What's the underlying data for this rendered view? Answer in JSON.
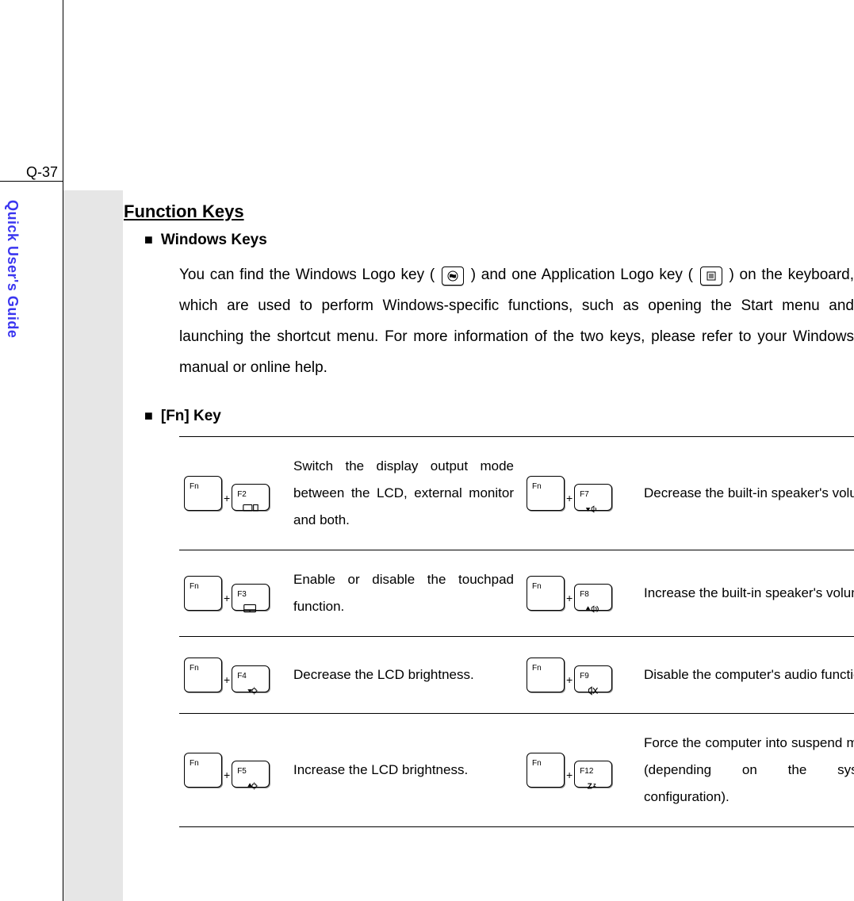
{
  "page_number": "Q-37",
  "side_tab": "Quick User's Guide",
  "section_title": "Function Keys",
  "subsections": {
    "windows": {
      "title": "Windows Keys",
      "para_before": "You can find the Windows Logo key (",
      "mid": ") and one Application Logo key (",
      "after": ") on the keyboard, which are used to perform Windows-specific functions, such as opening the Start menu and launching the shortcut menu.  For more information of the two keys, please refer to your Windows manual or online help."
    },
    "fnkey": {
      "title": "[Fn] Key"
    }
  },
  "fn_label": "Fn",
  "plus": "+",
  "fn_rows": [
    {
      "left_key": "F2",
      "left_icon": "display-icon",
      "left_desc": "Switch the display output mode between the LCD, external monitor and both.",
      "right_key": "F7",
      "right_icon": "vol-down-icon",
      "right_desc": "Decrease the built-in speaker's volume."
    },
    {
      "left_key": "F3",
      "left_icon": "touchpad-icon",
      "left_desc": "Enable or disable the touchpad function.",
      "right_key": "F8",
      "right_icon": "vol-up-icon",
      "right_desc": "Increase the built-in speaker's volume."
    },
    {
      "left_key": "F4",
      "left_icon": "bright-down-icon",
      "left_desc": "Decrease the LCD brightness.",
      "right_key": "F9",
      "right_icon": "mute-icon",
      "right_desc": "Disable the computer's audio function."
    },
    {
      "left_key": "F5",
      "left_icon": "bright-up-icon",
      "left_desc": "Increase the LCD brightness.",
      "right_key": "F12",
      "right_icon": "sleep-icon",
      "right_desc": "Force the computer into suspend mode (depending on the system configuration)."
    }
  ]
}
